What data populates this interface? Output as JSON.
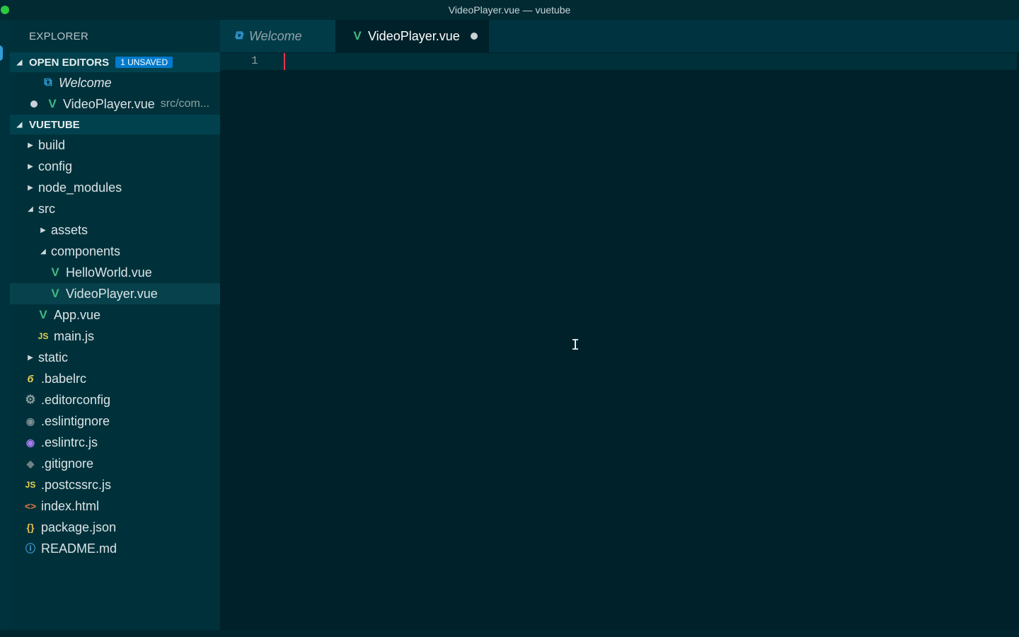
{
  "window": {
    "title": "VideoPlayer.vue — vuetube"
  },
  "sidebar": {
    "title": "EXPLORER",
    "open_editors": {
      "label": "OPEN EDITORS",
      "badge": "1 UNSAVED",
      "items": [
        {
          "label": "Welcome",
          "icon": "vscode-icon"
        },
        {
          "label": "VideoPlayer.vue",
          "path": "src/com...",
          "icon": "vue-icon",
          "unsaved": true
        }
      ]
    },
    "project": {
      "label": "VUETUBE",
      "items": [
        {
          "label": "build",
          "type": "folder",
          "expanded": false
        },
        {
          "label": "config",
          "type": "folder",
          "expanded": false
        },
        {
          "label": "node_modules",
          "type": "folder",
          "expanded": false
        },
        {
          "label": "src",
          "type": "folder",
          "expanded": true
        },
        {
          "label": "assets",
          "type": "folder",
          "expanded": false
        },
        {
          "label": "components",
          "type": "folder",
          "expanded": true
        },
        {
          "label": "HelloWorld.vue",
          "type": "file",
          "icon": "vue-icon"
        },
        {
          "label": "VideoPlayer.vue",
          "type": "file",
          "icon": "vue-icon",
          "selected": true
        },
        {
          "label": "App.vue",
          "type": "file",
          "icon": "vue-icon"
        },
        {
          "label": "main.js",
          "type": "file",
          "icon": "js-icon",
          "icon_text": "JS"
        },
        {
          "label": "static",
          "type": "folder",
          "expanded": false
        },
        {
          "label": ".babelrc",
          "type": "file",
          "icon": "babel-icon"
        },
        {
          "label": ".editorconfig",
          "type": "file",
          "icon": "gear-icon"
        },
        {
          "label": ".eslintignore",
          "type": "file",
          "icon": "eslint-ignore-icon"
        },
        {
          "label": ".eslintrc.js",
          "type": "file",
          "icon": "eslint-icon"
        },
        {
          "label": ".gitignore",
          "type": "file",
          "icon": "git-icon"
        },
        {
          "label": ".postcssrc.js",
          "type": "file",
          "icon": "js-icon",
          "icon_text": "JS"
        },
        {
          "label": "index.html",
          "type": "file",
          "icon": "html-icon"
        },
        {
          "label": "package.json",
          "type": "file",
          "icon": "json-icon",
          "icon_text": "{}"
        },
        {
          "label": "README.md",
          "type": "file",
          "icon": "info-icon"
        }
      ]
    }
  },
  "tabs": [
    {
      "label": "Welcome",
      "active": false,
      "icon": "vscode-icon"
    },
    {
      "label": "VideoPlayer.vue",
      "active": true,
      "icon": "vue-icon",
      "unsaved": true
    }
  ],
  "editor": {
    "line_numbers": [
      "1"
    ]
  },
  "colors": {
    "accent": "#007acc",
    "vue": "#41b883",
    "background": "#002129",
    "sidebar": "#00313b",
    "caret": "#e8374f"
  }
}
